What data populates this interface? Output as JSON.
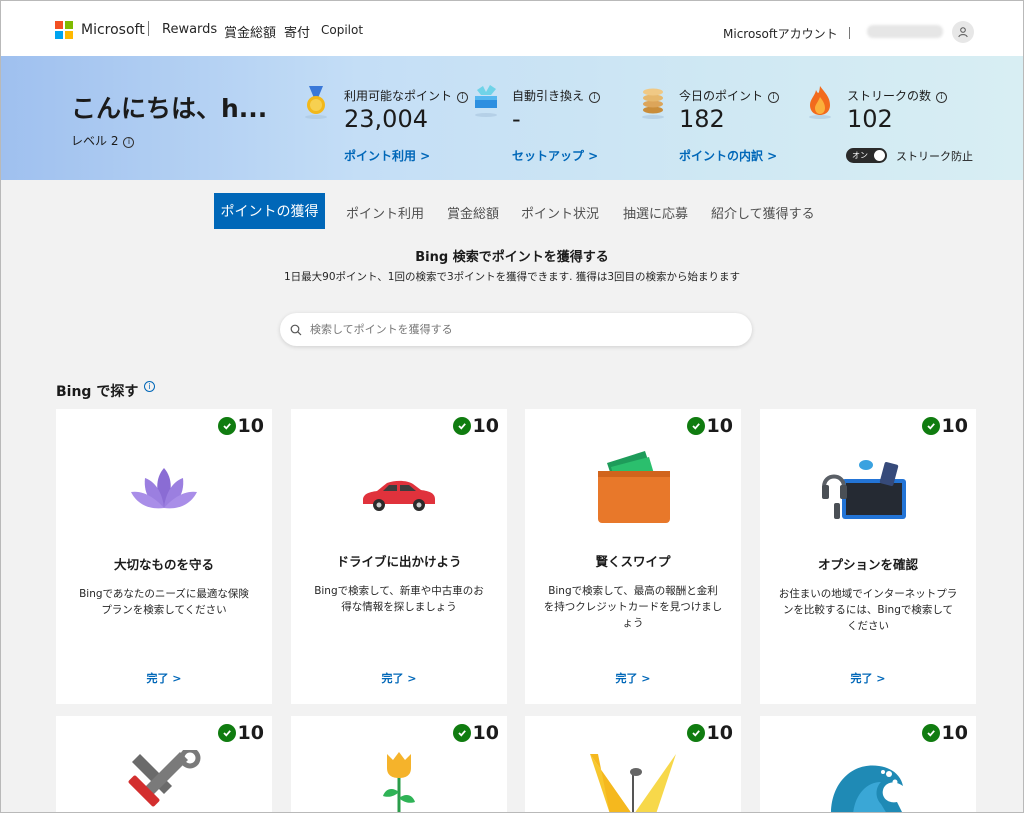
{
  "header": {
    "brand": "Microsoft",
    "nav": [
      "Rewards",
      "賞金総額",
      "寄付",
      "Copilot"
    ],
    "account_label": "Microsoftアカウント"
  },
  "hero": {
    "greeting": "こんにちは、h...",
    "level": "レベル 2",
    "stats": [
      {
        "label": "利用可能なポイント",
        "value": "23,004",
        "link": "ポイント利用 >",
        "icon": "medal-icon"
      },
      {
        "label": "自動引き換え",
        "value": "-",
        "link": "セットアップ >",
        "icon": "gift-box-icon"
      },
      {
        "label": "今日のポイント",
        "value": "182",
        "link": "ポイントの内訳 >",
        "icon": "coin-stack-icon"
      },
      {
        "label": "ストリークの数",
        "value": "102",
        "icon": "flame-icon"
      }
    ],
    "toggle_state": "オン",
    "toggle_label": "ストリーク防止"
  },
  "tabs": [
    "ポイントの獲得",
    "ポイント利用",
    "賞金総額",
    "ポイント状況",
    "抽選に応募",
    "紹介して獲得する"
  ],
  "search": {
    "title": "Bing 検索でポイントを獲得する",
    "subtitle": "1日最大90ポイント、1回の検索で3ポイントを獲得できます. 獲得は3回目の検索から始まります",
    "placeholder": "検索してポイントを獲得する"
  },
  "section": {
    "title": "Bing で探す"
  },
  "cards": [
    {
      "points": "10",
      "title": "大切なものを守る",
      "desc": "Bingであなたのニーズに最適な保険プランを検索してください",
      "link": "完了 >",
      "art": "lotus-icon"
    },
    {
      "points": "10",
      "title": "ドライブに出かけよう",
      "desc": "Bingで検索して、新車や中古車のお得な情報を探しましょう",
      "link": "完了 >",
      "art": "car-icon"
    },
    {
      "points": "10",
      "title": "賢くスワイプ",
      "desc": "Bingで検索して、最高の報酬と金利を持つクレジットカードを見つけましょう",
      "link": "完了 >",
      "art": "wallet-icon"
    },
    {
      "points": "10",
      "title": "オプションを確認",
      "desc": "お住まいの地域でインターネットプランを比較するには、Bingで検索してください",
      "link": "完了 >",
      "art": "devices-icon"
    },
    {
      "points": "10",
      "art": "tools-icon"
    },
    {
      "points": "10",
      "art": "tulip-icon"
    },
    {
      "points": "10",
      "art": "stage-lights-icon"
    },
    {
      "points": "10",
      "art": "wave-icon"
    }
  ],
  "colors": {
    "accent": "#0067b8",
    "check": "#107c10"
  }
}
